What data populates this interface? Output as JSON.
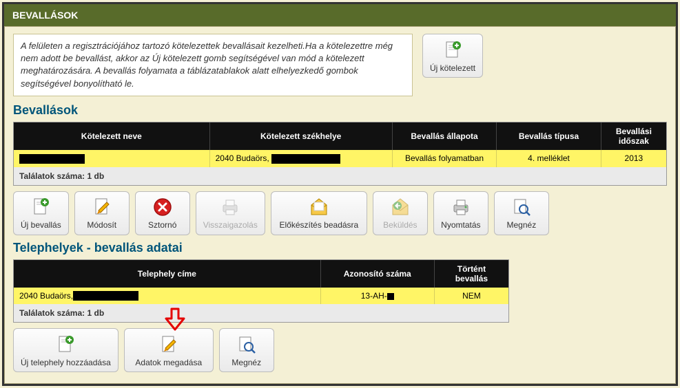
{
  "header": {
    "title": "BEVALLÁSOK"
  },
  "intro": "A felületen a regisztrációjához tartozó kötelezettek bevallásait kezelheti.Ha a kötelezettre még nem adott be bevallást, akkor az Új kötelezett gomb segítségével van mód a kötelezett meghatározására. A bevallás folyamata a táblázatablakok alatt elhelyezkedő gombok segítségével bonyolítható le.",
  "top_button": {
    "label": "Új kötelezett"
  },
  "section1": {
    "title": "Bevallások",
    "headers": [
      "Kötelezett neve",
      "Kötelezett székhelye",
      "Bevallás állapota",
      "Bevallás típusa",
      "Bevallási időszak"
    ],
    "row": {
      "szekhely_prefix": "2040 Budaörs,",
      "allapota": "Bevallás folyamatban",
      "tipusa": "4. melléklet",
      "idoszak": "2013"
    },
    "result": "Találatok száma: 1 db",
    "buttons": {
      "uj_bevallas": "Új bevallás",
      "modosit": "Módosít",
      "szterno": "Sztornó",
      "vissza": "Visszaigazolás",
      "elokeszites": "Előkészítés beadásra",
      "bekuldes": "Beküldés",
      "nyomtatas": "Nyomtatás",
      "megnez": "Megnéz"
    }
  },
  "section2": {
    "title": "Telephelyek - bevallás adatai",
    "headers": [
      "Telephely címe",
      "Azonosító száma",
      "Történt bevallás"
    ],
    "row": {
      "cim_prefix": "2040 Budaörs,",
      "azonosito": "13-AH-",
      "tortent": "NEM"
    },
    "result": "Találatok száma: 1 db",
    "buttons": {
      "uj_telephely": "Új telephely hozzáadása",
      "adatok": "Adatok megadása",
      "megnez": "Megnéz"
    }
  }
}
